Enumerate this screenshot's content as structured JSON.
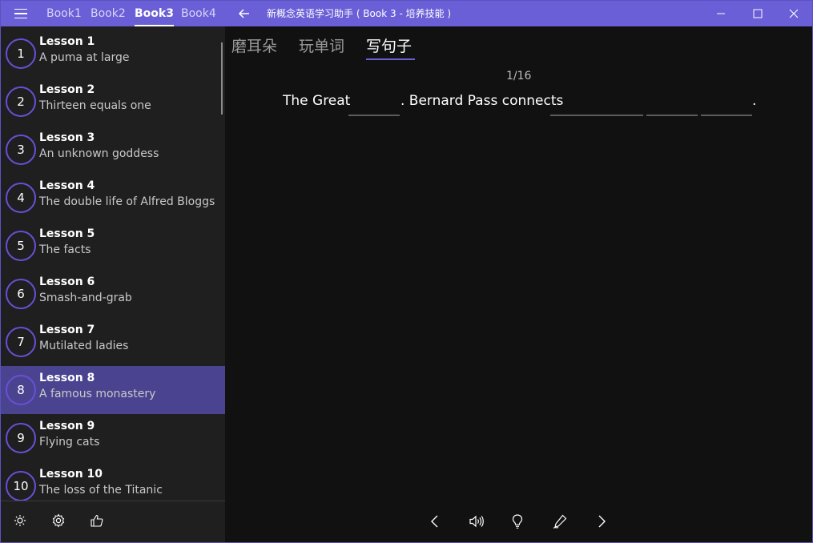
{
  "titlebar": {
    "books": [
      "Book1",
      "Book2",
      "Book3",
      "Book4"
    ],
    "active_book": "Book3",
    "title": "新概念英语学习助手 ( Book 3 - 培养技能 )"
  },
  "lessons": [
    {
      "number": "1",
      "title": "Lesson 1",
      "subtitle": "A puma at large"
    },
    {
      "number": "2",
      "title": "Lesson 2",
      "subtitle": "Thirteen equals one"
    },
    {
      "number": "3",
      "title": "Lesson 3",
      "subtitle": "An unknown goddess"
    },
    {
      "number": "4",
      "title": "Lesson 4",
      "subtitle": "The double life of Alfred Bloggs"
    },
    {
      "number": "5",
      "title": "Lesson 5",
      "subtitle": "The facts"
    },
    {
      "number": "6",
      "title": "Lesson 6",
      "subtitle": "Smash-and-grab"
    },
    {
      "number": "7",
      "title": "Lesson 7",
      "subtitle": "Mutilated ladies"
    },
    {
      "number": "8",
      "title": "Lesson 8",
      "subtitle": "A famous monastery"
    },
    {
      "number": "9",
      "title": "Lesson 9",
      "subtitle": "Flying cats"
    },
    {
      "number": "10",
      "title": "Lesson 10",
      "subtitle": "The loss of the Titanic"
    }
  ],
  "selected_lesson": "8",
  "footer_icons": [
    "brightness-icon",
    "settings-gear-icon",
    "thumbs-up-icon"
  ],
  "pivot": {
    "tabs": [
      "磨耳朵",
      "玩单词",
      "写句子"
    ],
    "active": "写句子"
  },
  "exercise": {
    "progress": "1/16",
    "segments": [
      "The Great",
      ". Bernard Pass connects",
      "."
    ]
  },
  "controls": [
    "previous-icon",
    "speaker-icon",
    "hint-bulb-icon",
    "write-pen-icon",
    "next-icon"
  ],
  "colors": {
    "accent": "#6a5fd6",
    "titlebar": "#6a5fd6",
    "selected_row": "#4a4490",
    "circle_border": "#6a4fd6",
    "sidebar_bg": "#1f1f1f",
    "main_bg": "#111111"
  }
}
